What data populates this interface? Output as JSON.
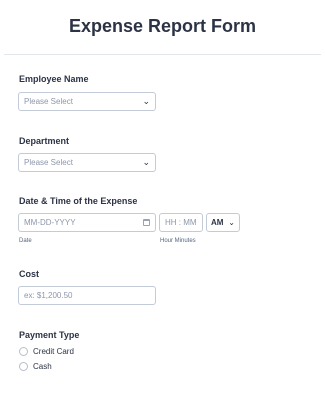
{
  "form": {
    "title": "Expense Report Form",
    "employee": {
      "label": "Employee Name",
      "placeholder": "Please Select"
    },
    "department": {
      "label": "Department",
      "placeholder": "Please Select"
    },
    "datetime": {
      "label": "Date & Time of the Expense",
      "date_placeholder": "MM-DD-YYYY",
      "date_sublabel": "Date",
      "time_placeholder": "HH : MM",
      "time_sublabel": "Hour Minutes",
      "ampm_value": "AM"
    },
    "cost": {
      "label": "Cost",
      "placeholder": "ex: $1,200.50"
    },
    "payment": {
      "label": "Payment Type",
      "options": [
        "Credit Card",
        "Cash"
      ]
    }
  }
}
